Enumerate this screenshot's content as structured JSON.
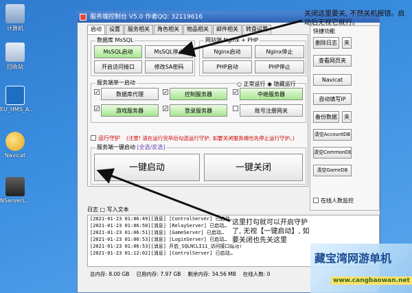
{
  "desktop": {
    "icons": [
      {
        "label": "计算机"
      },
      {
        "label": "回收站"
      },
      {
        "label": "EU_HMS_A..."
      },
      {
        "label": "Navicat"
      },
      {
        "label": "NServerL..."
      }
    ]
  },
  "window": {
    "title": "服务端控制台 V5.0 作者QQ: 32119616",
    "tabs": [
      "启动",
      "设置",
      "服务相关",
      "角色相关",
      "物品相关",
      "邮件相关",
      "转盘设置"
    ],
    "mysql_group": {
      "title": "数据库 MsSQL",
      "start": "MsSQL启动",
      "stop": "MsSQL停止",
      "open_port": "开启访问接口",
      "change_pwd": "修改SA密码"
    },
    "nginx_group": {
      "title": "网站端 Nginx + PHP",
      "nginx_start": "Nginx启动",
      "nginx_stop": "Nginx停止",
      "php_start": "PHP启动",
      "php_stop": "PHP停止"
    },
    "service_group": {
      "title": "服务端单一启动",
      "mode_normal": "正常运行",
      "mode_hidden": "隐藏运行",
      "buttons": [
        "数据库代理",
        "控制服务器",
        "中继服务器",
        "游戏服务器",
        "登录服务器",
        "账号注册网关"
      ]
    },
    "guard": {
      "label": "运行守护",
      "note": "(注意! 请在运行完毕后勾选运行守护, 如要关闭服务端也先停止运行守护。)"
    },
    "oneclick": {
      "title": "服务端一键启动",
      "select_label": "[全选/反选]",
      "start": "一键启动",
      "stop": "一键关闭"
    },
    "quick": {
      "title": "快捷功能",
      "buttons": [
        "删除日志",
        "夹",
        "查看网页夹",
        "Navicat",
        "自动填写IP",
        "备份数据",
        "夹",
        "清空AccountDB",
        "清空CommonDB",
        "清空GameDB"
      ],
      "online_monitor": "在线人数监控"
    },
    "log": {
      "tabs": [
        "日志",
        "写入文本"
      ],
      "lines": [
        "[2021-01-23 01:06:49][消息] [ControlServer] 已启动…",
        "[2021-01-23 01:06:50][消息] [RelayServer] 已启动…",
        "[2021-01-23 01:06:51][消息] [GameServer] 已启动…",
        "[2021-01-23 01:06:53][消息] [LoginServer] 已启动…",
        "[2021-01-23 01:06:53][消息] 开启_SQLNCLI11_访问接口成功!",
        "[2021-01-23 01:12:02][消息] [ControlServer] 已启动…"
      ]
    },
    "status": {
      "total_mem": "总内存: 8.00 GB",
      "used_mem": "已用内存: 7.97 GB",
      "free_mem": "剩余内存: 34.56 MB",
      "online": "在线人数: 0"
    }
  },
  "annotations": {
    "top": "关闭这里要关, 不然关机报错。启动后无视它就行。",
    "bottom": "这里打勾就可以开启守护了, 无视【一键启动】, 如要关闭也先关这里"
  },
  "watermark": {
    "text": "藏宝湾网游单机",
    "url": "www.cangbaowan.net"
  }
}
